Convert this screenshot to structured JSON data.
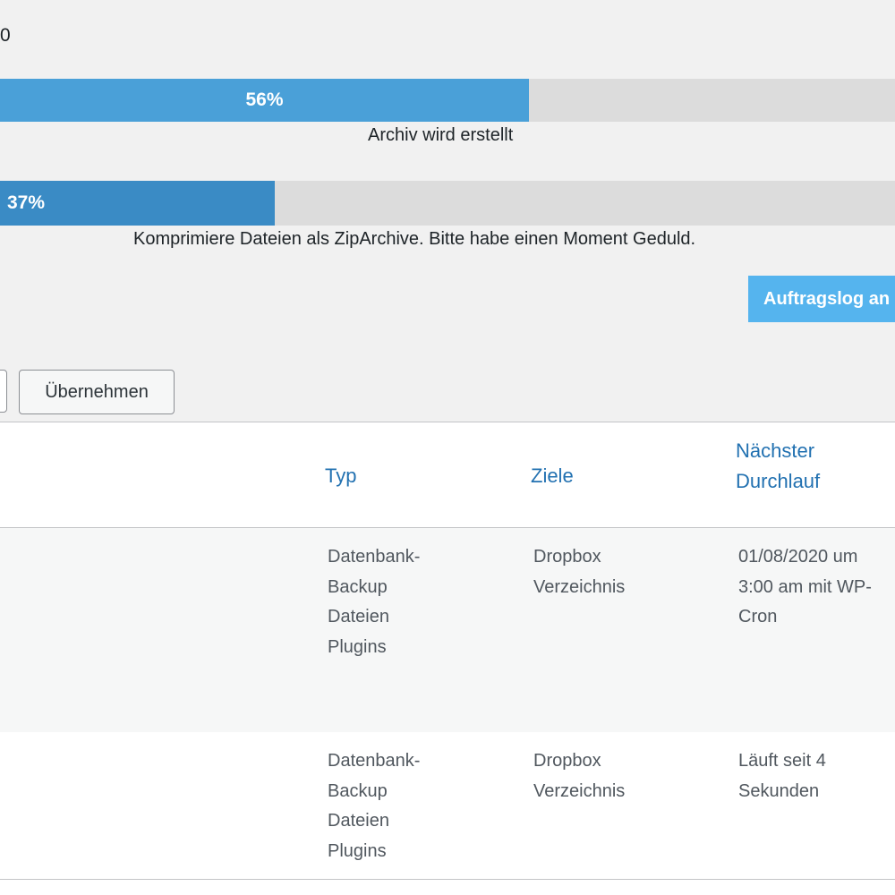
{
  "status": {
    "counter_text": "0"
  },
  "progress": {
    "main": {
      "percent": 56,
      "label": "56%",
      "caption": "Archiv wird erstellt"
    },
    "step": {
      "percent": 37,
      "label": "37%",
      "caption": "Komprimiere Dateien als ZipArchive. Bitte habe einen Moment Geduld."
    }
  },
  "actions": {
    "log_button_label": "Auftragslog an",
    "apply_button_label": "Übernehmen"
  },
  "table": {
    "headers": {
      "typ": "Typ",
      "ziele": "Ziele",
      "next_line1": "Nächster",
      "next_line2": "Durchlauf"
    },
    "rows": [
      {
        "typ": [
          "Datenbank-",
          "Backup",
          "Dateien",
          "Plugins"
        ],
        "ziele": [
          "Dropbox",
          "Verzeichnis"
        ],
        "next": [
          "01/08/2020 um",
          "3:00 am mit WP-",
          "Cron"
        ]
      },
      {
        "typ": [
          "Datenbank-",
          "Backup",
          "Dateien",
          "Plugins"
        ],
        "ziele": [
          "Dropbox",
          "Verzeichnis"
        ],
        "next": [
          "Läuft seit 4",
          "Sekunden"
        ]
      }
    ]
  },
  "colors": {
    "progress_main": "#4aa0d8",
    "progress_step": "#3a8bc5",
    "progress_track": "#dcdcdc",
    "link": "#2271b1",
    "primary_button": "#55b4ee"
  }
}
